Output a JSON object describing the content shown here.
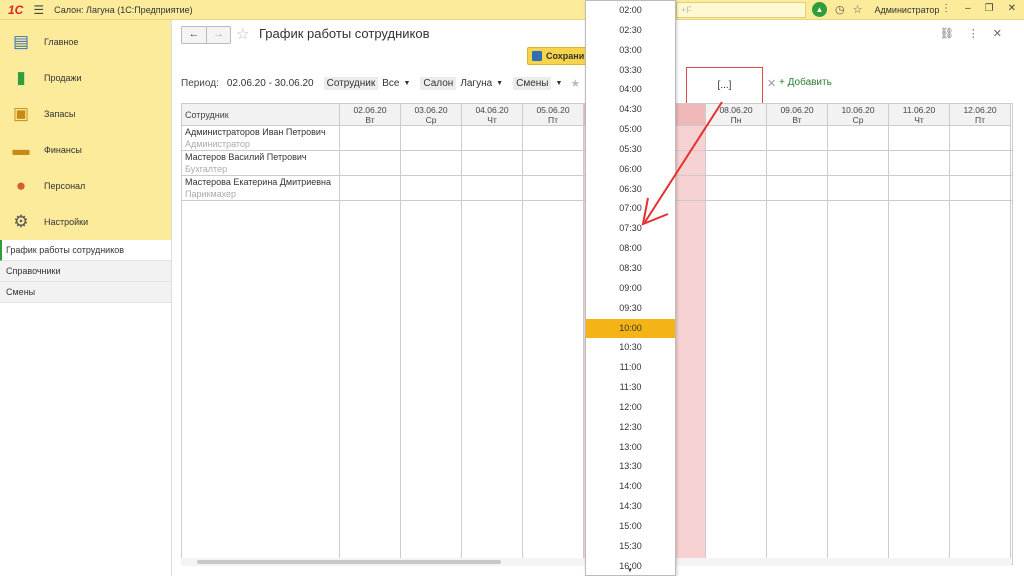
{
  "titlebar": {
    "logo": "1С",
    "menu_icon": "hamburger-icon",
    "app_title": "Салон: Лагуна  (1С:Предприятие)",
    "search_placeholder": "+F",
    "user": "Администратор"
  },
  "sidebar": {
    "sections": [
      {
        "label": "Главное",
        "icon": "main-icon",
        "color": "#3a6fb5"
      },
      {
        "label": "Продажи",
        "icon": "sales-chart-icon",
        "color": "#2e9d3a"
      },
      {
        "label": "Запасы",
        "icon": "stock-icon",
        "color": "#c98a14"
      },
      {
        "label": "Финансы",
        "icon": "wallet-icon",
        "color": "#c98a14"
      },
      {
        "label": "Персонал",
        "icon": "staff-icon",
        "color": "#d25f2f"
      },
      {
        "label": "Настройки",
        "icon": "gear-icon",
        "color": "#555555"
      }
    ],
    "nav": [
      {
        "label": "График работы сотрудников",
        "active": true
      },
      {
        "label": "Справочники",
        "active": false
      },
      {
        "label": "Смены",
        "active": false
      }
    ]
  },
  "main": {
    "title": "График работы сотрудников",
    "save_label": "Сохрани",
    "filters": {
      "period_label": "Период:",
      "period_value": "02.06.20 - 30.06.20",
      "employee_label": "Сотрудник",
      "employee_value": "Все",
      "salon_label": "Салон",
      "salon_value": "Лагуна",
      "shifts_label": "Смены"
    },
    "shift_box": "[...]",
    "add_label": "+ Добавить",
    "grid": {
      "employee_header": "Сотрудник",
      "days": [
        {
          "date": "02.06.20",
          "dow": "Вт",
          "weekend": false
        },
        {
          "date": "03.06.20",
          "dow": "Ср",
          "weekend": false
        },
        {
          "date": "04.06.20",
          "dow": "Чт",
          "weekend": false
        },
        {
          "date": "05.06.20",
          "dow": "Пт",
          "weekend": false
        },
        {
          "date": "",
          "dow": "",
          "weekend": true
        },
        {
          "date": "",
          "dow": "",
          "weekend": true
        },
        {
          "date": "08.06.20",
          "dow": "Пн",
          "weekend": false
        },
        {
          "date": "09.06.20",
          "dow": "Вт",
          "weekend": false
        },
        {
          "date": "10.06.20",
          "dow": "Ср",
          "weekend": false
        },
        {
          "date": "11.06.20",
          "dow": "Чт",
          "weekend": false
        },
        {
          "date": "12.06.20",
          "dow": "Пт",
          "weekend": false
        }
      ],
      "employees": [
        {
          "name": "Администраторов Иван Петрович",
          "role": "Администратор"
        },
        {
          "name": "Мастеров Василий Петрович",
          "role": "Бухгалтер"
        },
        {
          "name": "Мастерова Екатерина Дмитриевна",
          "role": "Парикмахер"
        }
      ]
    }
  },
  "dropdown": {
    "times": [
      "02:00",
      "02:30",
      "03:00",
      "03:30",
      "04:00",
      "04:30",
      "05:00",
      "05:30",
      "06:00",
      "06:30",
      "07:00",
      "07:30",
      "08:00",
      "08:30",
      "09:00",
      "09:30",
      "10:00",
      "10:30",
      "11:00",
      "11:30",
      "12:00",
      "12:30",
      "13:00",
      "13:30",
      "14:00",
      "14:30",
      "15:00",
      "15:30",
      "16:00"
    ],
    "selected": "10:00"
  }
}
